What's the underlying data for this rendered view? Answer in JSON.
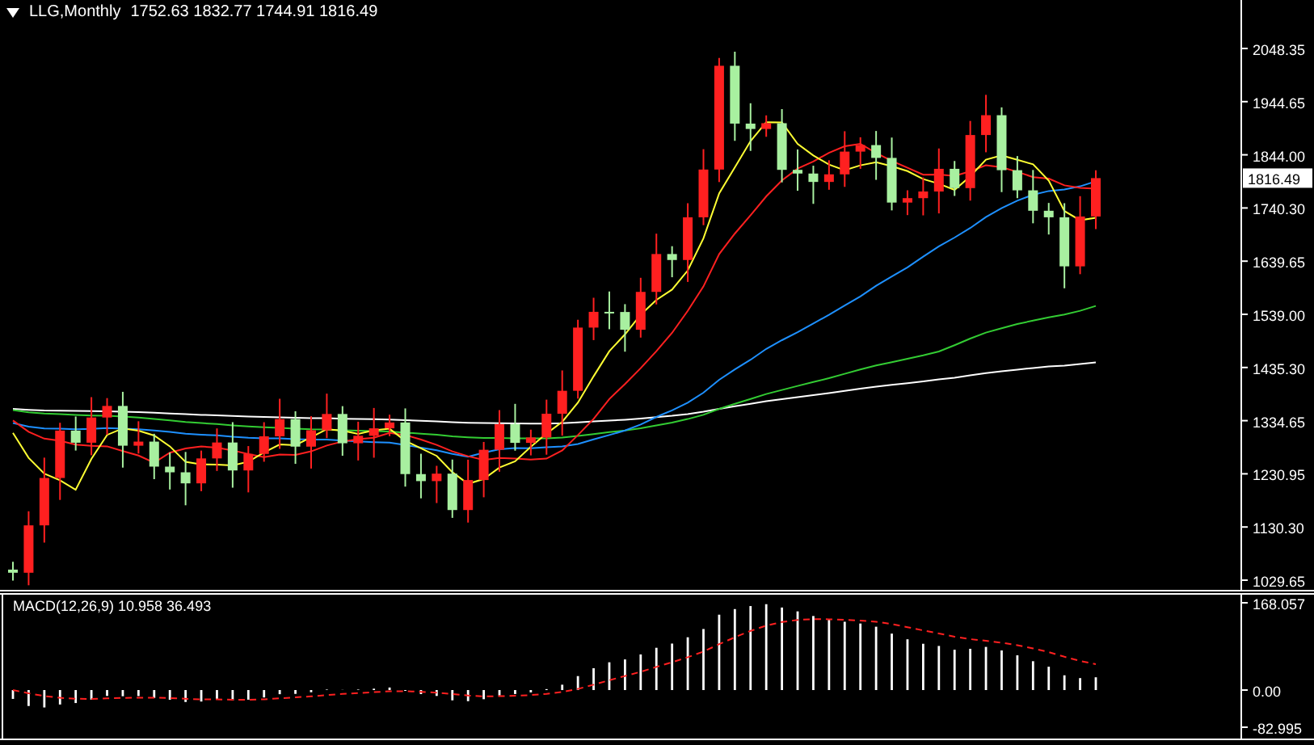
{
  "chart_header": {
    "symbol": "LLG,Monthly",
    "ohlc": "1752.63 1832.77 1744.91 1816.49"
  },
  "price_axis": {
    "ticks": [
      "2048.35",
      "1944.65",
      "1844.00",
      "1740.30",
      "1639.65",
      "1539.00",
      "1435.30",
      "1334.65",
      "1230.95",
      "1130.30",
      "1029.65"
    ],
    "current_price": "1816.49"
  },
  "macd_panel": {
    "label": "MACD(12,26,9) 10.958 36.493",
    "ticks": [
      "168.057",
      "0.00",
      "-82.995"
    ]
  }
}
